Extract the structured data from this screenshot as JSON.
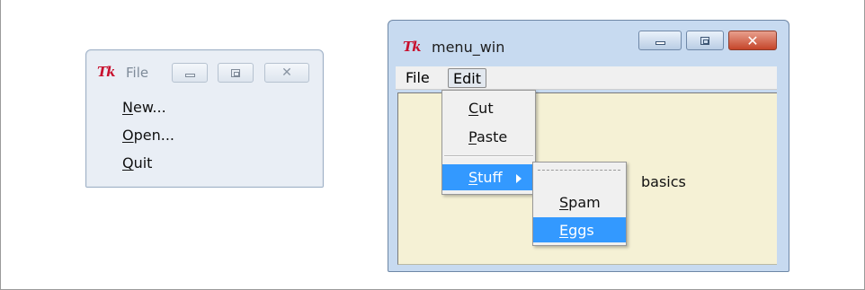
{
  "tearoff_window": {
    "title": "File",
    "items": [
      {
        "label": "New...",
        "mnemonic": "N",
        "rest": "ew..."
      },
      {
        "label": "Open...",
        "mnemonic": "O",
        "rest": "pen..."
      },
      {
        "label": "Quit",
        "mnemonic": "Q",
        "rest": "uit"
      }
    ]
  },
  "main_window": {
    "title": "menu_win",
    "menubar": [
      "File",
      "Edit"
    ],
    "content_text": "basics"
  },
  "edit_menu": {
    "items": [
      {
        "label": "Cut",
        "mnemonic": "C",
        "rest": "ut"
      },
      {
        "label": "Paste",
        "mnemonic": "P",
        "rest": "aste"
      },
      {
        "label": "Stuff",
        "mnemonic": "S",
        "rest": "tuff",
        "has_submenu": true,
        "selected": true
      }
    ]
  },
  "stuff_menu": {
    "items": [
      {
        "label": "Spam",
        "mnemonic": "S",
        "rest": "pam"
      },
      {
        "label": "Eggs",
        "mnemonic": "E",
        "rest": "ggs",
        "selected": true
      }
    ]
  },
  "icons": {
    "app_logo": "Tk",
    "minimize": "minimize-icon",
    "maximize": "maximize-icon",
    "close": "close-icon",
    "submenu_arrow": "submenu-arrow-icon"
  },
  "colors": {
    "selection": "#3399ff",
    "content_bg": "#f5f1d5",
    "close_button": "#c5452a"
  }
}
